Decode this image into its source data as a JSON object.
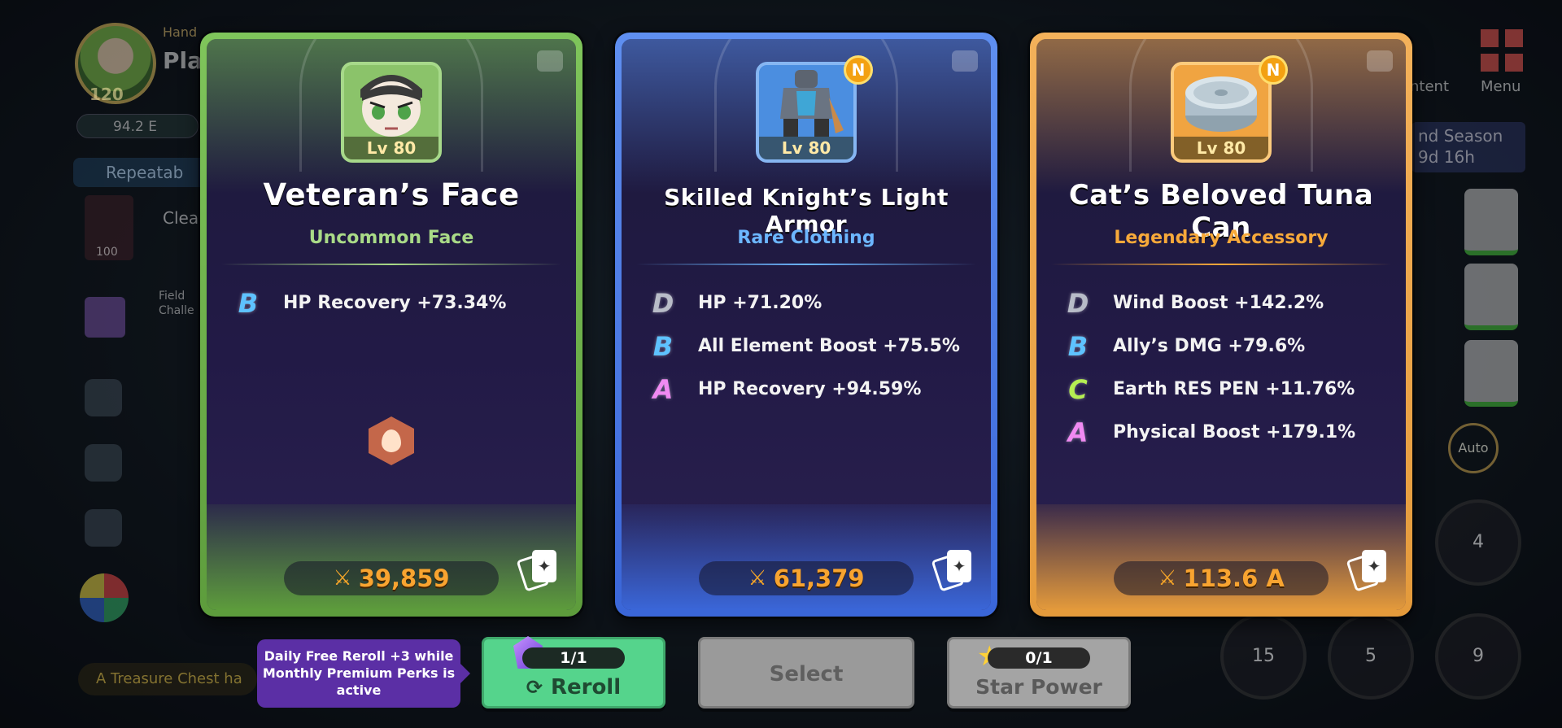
{
  "hud": {
    "player_level": "120",
    "player_name": "Pla",
    "player_tag": "Hand",
    "power_value": "94.2 E",
    "repeat_label": "Repeatab",
    "gem_count": "100",
    "clear_text": "Clea",
    "field_text_1": "Field",
    "field_text_2": "Challe",
    "chest_text": "A Treasure Chest ha",
    "content_label": "ntent",
    "menu_label": "Menu",
    "season_line1": "nd Season",
    "season_line2": "9d 16h",
    "auto_label": "Auto",
    "skills": [
      "4",
      "15",
      "5",
      "9"
    ]
  },
  "cards": [
    {
      "rarity_color": "#7fc55b",
      "title": "Veteran’s Face",
      "subtitle": "Uncommon Face",
      "level": "Lv 80",
      "is_new": false,
      "stats": [
        {
          "grade": "B",
          "text": "HP Recovery +73.34%"
        }
      ],
      "has_element_icon": true,
      "power": "39,859"
    },
    {
      "rarity_color": "#5f8ff0",
      "title": "Skilled Knight’s Light Armor",
      "subtitle": "Rare Clothing",
      "level": "Lv 80",
      "is_new": true,
      "new_badge": "N",
      "stats": [
        {
          "grade": "D",
          "text": "HP +71.20%"
        },
        {
          "grade": "B",
          "text": "All Element Boost +75.5%"
        },
        {
          "grade": "A",
          "text": "HP Recovery +94.59%"
        }
      ],
      "has_element_icon": false,
      "power": "61,379"
    },
    {
      "rarity_color": "#f3b15a",
      "title": "Cat’s Beloved Tuna Can",
      "subtitle": "Legendary Accessory",
      "level": "Lv 80",
      "is_new": true,
      "new_badge": "N",
      "stats": [
        {
          "grade": "D",
          "text": "Wind Boost +142.2%"
        },
        {
          "grade": "B",
          "text": "Ally’s DMG +79.6%"
        },
        {
          "grade": "C",
          "text": "Earth RES PEN +11.76%"
        },
        {
          "grade": "A",
          "text": "Physical Boost +179.1%"
        }
      ],
      "has_element_icon": false,
      "power": "113.6 A"
    }
  ],
  "actions": {
    "tooltip": "Daily Free Reroll +3 while Monthly Premium Perks is active",
    "reroll": {
      "counter": "1/1",
      "label": "Reroll"
    },
    "select": {
      "label": "Select"
    },
    "star_power": {
      "counter": "0/1",
      "label": "Star Power"
    }
  },
  "icons": {
    "sword": "crossed-swords-icon",
    "cards": "card-swap-icon",
    "gem": "gem-icon",
    "refresh": "refresh-icon",
    "star": "star-icon"
  }
}
